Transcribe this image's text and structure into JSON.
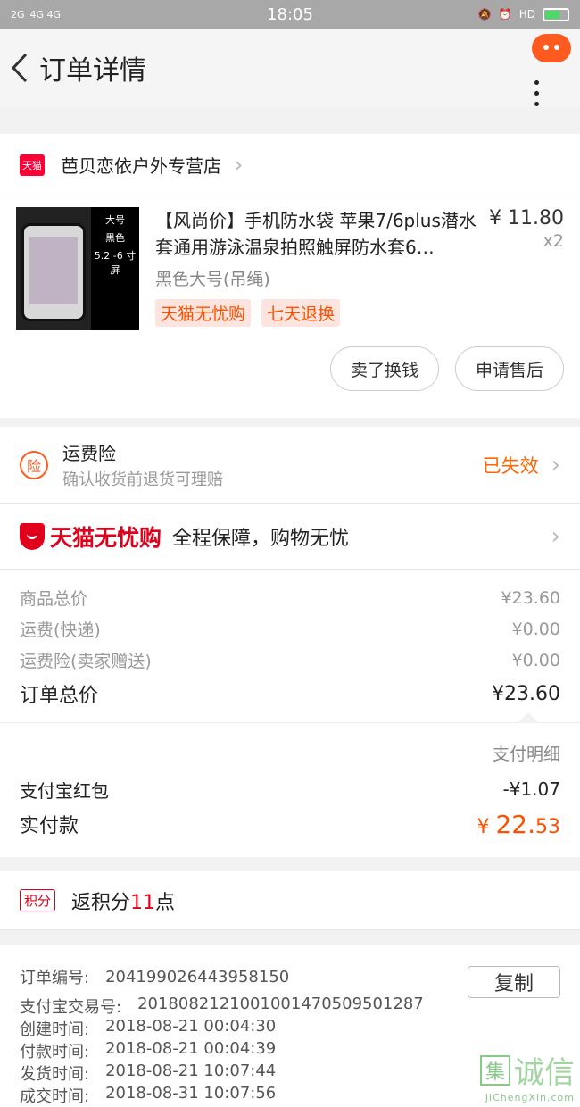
{
  "status_bar": {
    "signal1": "2G",
    "signal2": "4G 4G",
    "time": "18:05",
    "hd": "HD"
  },
  "nav": {
    "title": "订单详情"
  },
  "shop": {
    "badge": "天猫",
    "name": "芭贝恋依户外专营店"
  },
  "item": {
    "title": "【风尚价】手机防水袋 苹果7/6plus潜水套通用游泳温泉拍照触屏防水套6…",
    "sku": "黑色大号(吊绳)",
    "badges": [
      "天猫无忧购",
      "七天退换"
    ],
    "price": "¥ 11.80",
    "qty": "x2",
    "thumb_tags": [
      "大号",
      "黑色",
      "5.2 -6 寸屏"
    ]
  },
  "actions": {
    "sell": "卖了换钱",
    "after_sale": "申请售后"
  },
  "insurance": {
    "icon_text": "险",
    "title": "运费险",
    "subtitle": "确认收货前退货可理赔",
    "status": "已失效"
  },
  "worry_free": {
    "logo": "天猫无忧购",
    "text": "全程保障，购物无忧"
  },
  "fees": [
    {
      "label": "商品总价",
      "value": "¥23.60"
    },
    {
      "label": "运费(快递)",
      "value": "¥0.00"
    },
    {
      "label": "运费险(卖家赠送)",
      "value": "¥0.00"
    }
  ],
  "order_total": {
    "label": "订单总价",
    "value": "¥23.60"
  },
  "payment": {
    "detail_link": "支付明细",
    "redpacket_label": "支付宝红包",
    "redpacket_value": "-¥1.07",
    "real_label": "实付款",
    "real_currency": "¥",
    "real_int": "22.",
    "real_dec": "53"
  },
  "points": {
    "tag": "积分",
    "prefix": "返积分",
    "value": "11",
    "suffix": "点"
  },
  "order_info": {
    "order_no_label": "订单编号:",
    "order_no": "204199026443958150",
    "copy": "复制",
    "alipay_label": "支付宝交易号:",
    "alipay_no": "2018082121001001470509501287",
    "created_label": "创建时间:",
    "created": "2018-08-21  00:04:30",
    "paid_label": "付款时间:",
    "paid": "2018-08-21  00:04:39",
    "shipped_label": "发货时间:",
    "shipped": "2018-08-21  10:07:44",
    "done_label": "成交时间:",
    "done": "2018-08-31  10:07:56"
  },
  "watermark": {
    "box": "集",
    "text": "诚信",
    "sub": "JiChengXin.com"
  },
  "colors": {
    "accent": "#ff5000",
    "tmall_red": "#e0001b"
  }
}
